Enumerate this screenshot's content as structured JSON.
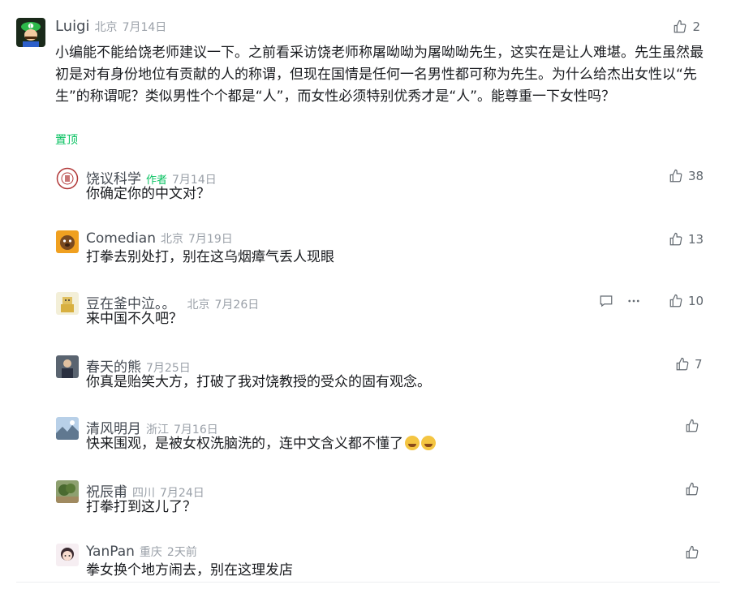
{
  "main_comment": {
    "author": "Luigi",
    "location": "北京",
    "date": "7月14日",
    "likes": "2",
    "text": "小编能不能给饶老师建议一下。之前看采访饶老师称屠呦呦为屠呦呦先生，这实在是让人难堪。先生虽然最初是对有身份地位有贡献的人的称谓，但现在国情是任何一名男性都可称为先生。为什么给杰出女性以“先生”的称谓呢？类似男性个个都是“人”，而女性必须特别优秀才是“人”。能尊重一下女性吗？",
    "pin_label": "置顶",
    "avatar_icon": "luigi-avatar-icon"
  },
  "replies": [
    {
      "author": "饶议科学",
      "author_tag": "作者",
      "location": "",
      "date": "7月14日",
      "likes": "38",
      "text": "你确定你的中文对？",
      "avatar_icon": "seal-avatar-icon"
    },
    {
      "author": "Comedian",
      "author_tag": "",
      "location": "北京",
      "date": "7月19日",
      "likes": "13",
      "text": "打拳去别处打，别在这乌烟瘴气丢人现眼",
      "avatar_icon": "dog-avatar-icon"
    },
    {
      "author": "豆在釜中泣。。",
      "author_tag": "",
      "location": "北京",
      "date": "7月26日",
      "likes": "10",
      "text": "来中国不久吧？",
      "avatar_icon": "cartoon-avatar-icon"
    },
    {
      "author": "春天的熊",
      "author_tag": "",
      "location": "",
      "date": "7月25日",
      "likes": "7",
      "text": "你真是贻笑大方，打破了我对饶教授的受众的固有观念。",
      "avatar_icon": "person-avatar-icon"
    },
    {
      "author": "清风明月",
      "author_tag": "",
      "location": "浙江",
      "date": "7月16日",
      "likes": "",
      "text": "快来围观，是被女权洗脑洗的，连中文含义都不懂了",
      "emoji": [
        "laugh-cry-emoji",
        "laugh-cry-emoji"
      ],
      "avatar_icon": "landscape-avatar-icon"
    },
    {
      "author": "祝辰甫",
      "author_tag": "",
      "location": "四川",
      "date": "7月24日",
      "likes": "",
      "text": "打拳打到这儿了？",
      "avatar_icon": "tree-avatar-icon"
    },
    {
      "author": "YanPan",
      "author_tag": "",
      "location": "重庆",
      "date": "2天前",
      "likes": "",
      "text": "拳女换个地方闹去，别在这理发店",
      "avatar_icon": "anime-girl-avatar-icon"
    }
  ],
  "colors": {
    "accent_green": "#07c160",
    "meta_gray": "#9aa0a8",
    "icon_gray": "#626970"
  }
}
